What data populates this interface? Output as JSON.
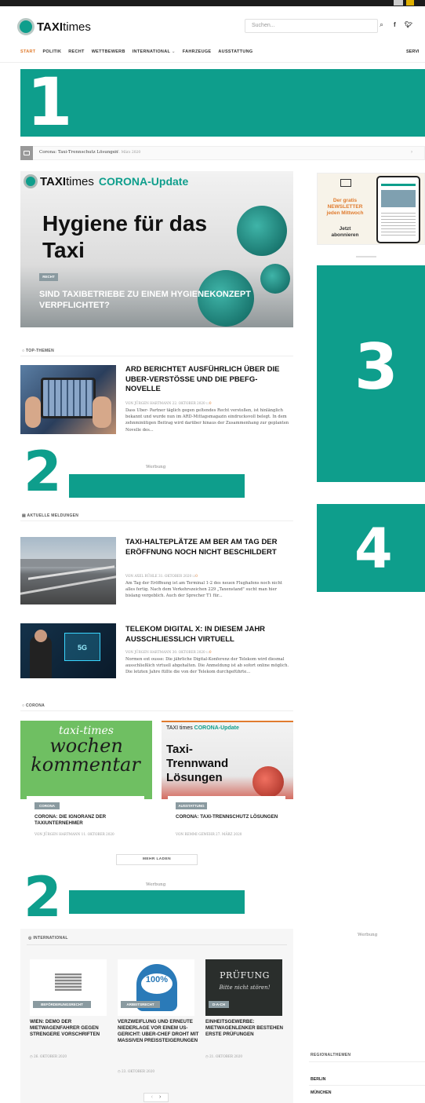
{
  "header": {
    "brand_bold": "TAXI",
    "brand_light": "times",
    "search_placeholder": "Suchen...",
    "search_icon": "search-icon",
    "social": [
      "f",
      "y"
    ]
  },
  "nav": {
    "items": [
      "START",
      "POLITIK",
      "RECHT",
      "WETTBEWERB",
      "INTERNATIONAL",
      "FAHRZEUGE",
      "AUSSTATTUNG"
    ],
    "right": "SERVI"
  },
  "placeholders": {
    "one": "1",
    "two": "2",
    "three": "3",
    "four": "4"
  },
  "ticker": {
    "text": "Corona: Taxi-Trennschutz Lösungen",
    "date": "27. März 2020"
  },
  "hero": {
    "brand_bold": "TAXI",
    "brand_light": "times",
    "campaign": "CORONA-Update",
    "title": "Hygiene für das Taxi",
    "badge": "RECHT",
    "caption": "SIND TAXIBETRIEBE ZU EINEM HYGIENEKONZEPT VERPFLICHTET?"
  },
  "top_themen": {
    "label": "TOP-THEMEN",
    "article": {
      "title": "ARD BERICHTET AUSFÜHRLICH ÜBER DIE UBER-VERSTÖSSE UND DIE PBEFG-NOVELLE",
      "meta": "VON JÜRGEN HARTMANN  22. OKTOBER 2020",
      "comments": "0",
      "text": "Dass Uber- Partner täglich gegen geltendes Recht verstoßen, ist hinlänglich bekannt und wurde nun im ARD-Mittagsmagazin eindrucksvoll belegt. In dem zehnminütigen Beitrag wird darüber hinaus der Zusammenhang zur geplanten Novelle des..."
    }
  },
  "werbung": "Werbung",
  "aktuelle": {
    "label": "AKTUELLE MELDUNGEN",
    "articles": [
      {
        "title": "TAXI-HALTEPLÄTZE AM BER AM TAG DER ERÖFFNUNG NOCH NICHT BESCHILDERT",
        "meta": "VON AXEL RÜHLE  31. OKTOBER 2020",
        "comments": "0",
        "text": "Am Tag der Eröffnung ist am Terminal 1-2 des neuen Flughafens noch nicht alles fertig. Nach dem Verkehrszeichen 229 „Taxenstand\" sucht man hier bislang vergeblich. Auch der Sprecher T1 für..."
      },
      {
        "title": "TELEKOM DIGITAL X: IN DIESEM JAHR AUSSCHLIESSLICH VIRTUELL",
        "meta": "VON JÜRGEN HARTMANN  30. OKTOBER 2020",
        "comments": "0",
        "text": "Normen ext ousse: Die jährliche Digital-Konferenz der Telekom wird diesmal ausschließlich virtuell abgehalten. Die Anmeldung ist ab sofort online möglich.  Die letzten Jahre füllte die von der Telekom durchgeführte..."
      }
    ]
  },
  "corona": {
    "label": "CORONA",
    "cards": [
      {
        "image_text_top": "taxi-times",
        "image_text_mid": "wochen",
        "image_text_bot": "kommentar",
        "badge": "CORONA",
        "title": "CORONA: DIE IGNORANZ DER TAXIUNTERNEHMER",
        "meta": "VON JÜRGEN HARTMANN  11. OKTOBER 2020"
      },
      {
        "image_brand": "TAXI times",
        "image_campaign": "CORONA-Update",
        "image_title": "Taxi-Trennwand Lösungen",
        "badge": "AUSSTATTUNG",
        "title": "CORONA: TAXI-TRENNSCHUTZ LÖSUNGEN",
        "meta": "VON REMMI GEWEHR  27. MÄRZ 2020"
      }
    ],
    "more": "MEHR LADEN"
  },
  "international": {
    "label": "INTERNATIONAL",
    "cards": [
      {
        "badge": "BEFÖRDERUNGSRECHT",
        "title": "WIEN: DEMO DER MIETWAGENFAHRER GEGEN STRENGERE VORSCHRIFTEN",
        "meta": "26. OKTOBER 2020"
      },
      {
        "badge": "ARBEITSRECHT",
        "image_text": "100%",
        "title": "VERZWEIFLUNG UND ERNEUTE NIEDERLAGE VOR EINEM US-GERICHT: UBER-CHEF DROHT MIT MASSIVEN PREISSTEIGERUNGEN",
        "meta": "23. OKTOBER 2020"
      },
      {
        "badge": "D-A-CH",
        "image_text": "PRÜFUNG",
        "image_text2": "Bitte nicht stören!",
        "title": "EINHEITSGEWERBE: MIETWAGENLENKER BESTEHEN ERSTE PRÜFUNGEN",
        "meta": "21. OKTOBER 2020"
      }
    ],
    "pager_prev": "‹",
    "pager_next": "›"
  },
  "sidebar": {
    "newsletter_line1": "Der gratis",
    "newsletter_line2": "NEWSLETTER",
    "newsletter_line3": "jeden Mittwoch",
    "newsletter_cta1": "Jetzt",
    "newsletter_cta2": "abonnieren",
    "werbung": "Werbung",
    "regional_label": "REGIONALTHEMEN",
    "regions": [
      "BERLIN",
      "MÜNCHEN"
    ]
  },
  "colors": {
    "accent": "#0e9e8c",
    "orange": "#e07b2e",
    "badge": "#8a9aa0"
  }
}
